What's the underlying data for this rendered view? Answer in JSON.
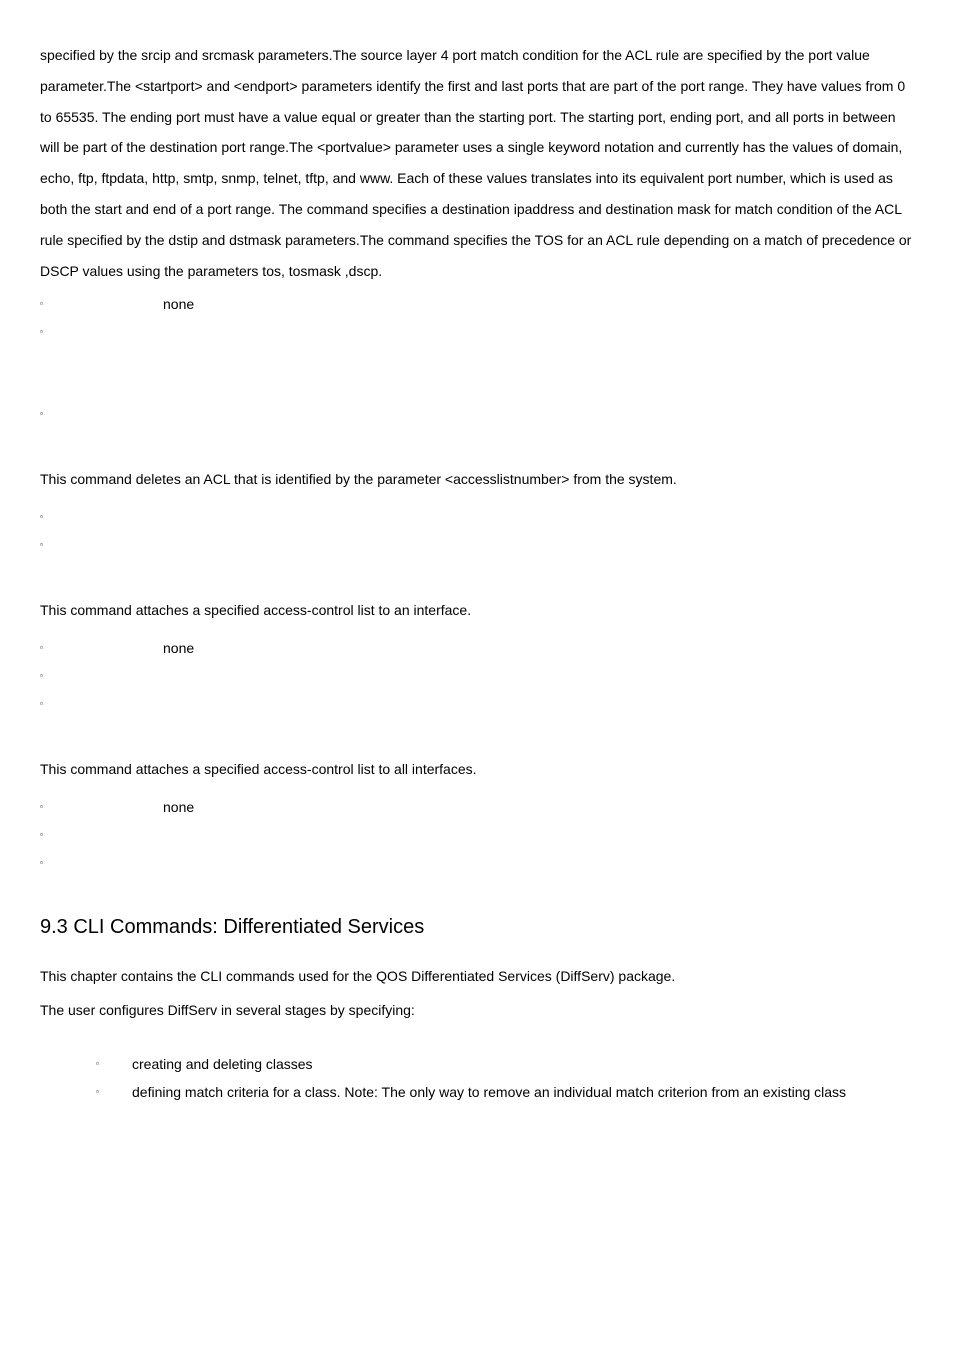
{
  "para1": "specified by the srcip and srcmask parameters.The source layer 4 port match condition for the ACL rule are specified by the port value parameter.The <startport> and <endport> parameters identify the first and last ports that are part of the port range. They have values from 0 to 65535. The ending port must have a value equal or greater than the starting port. The starting port, ending port, and all ports in between will be part of the destination port range.The <portvalue> parameter uses a single keyword notation and currently has the values of domain, echo, ftp, ftpdata, http, smtp, snmp, telnet, tftp, and www. Each of these values translates into its equivalent port number, which is used as both the start and end of a port range. The command specifies a destination ipaddress and destination mask for match condition of the ACL rule specified by the dstip and dstmask parameters.The command specifies the TOS for an ACL rule depending on a match of precedence or DSCP values using the parameters tos, tosmask ,dscp.",
  "none": "none",
  "section2_desc": "This command deletes an ACL that is identified by the parameter <accesslistnumber> from the system.",
  "section3_desc": "This command attaches a specified access-control list to an interface.",
  "section4_desc": "This command attaches a specified access-control list to all interfaces.",
  "heading": "9.3   CLI Commands: Differentiated Services",
  "diffserv_p1": "This chapter contains the CLI commands used for the QOS Differentiated Services (DiffServ) package.",
  "diffserv_p2": "The user configures DiffServ in several stages by specifying:",
  "sub1": "creating and deleting classes",
  "sub2": "defining match criteria for a class. Note: The only way to remove an individual match criterion from an existing class"
}
